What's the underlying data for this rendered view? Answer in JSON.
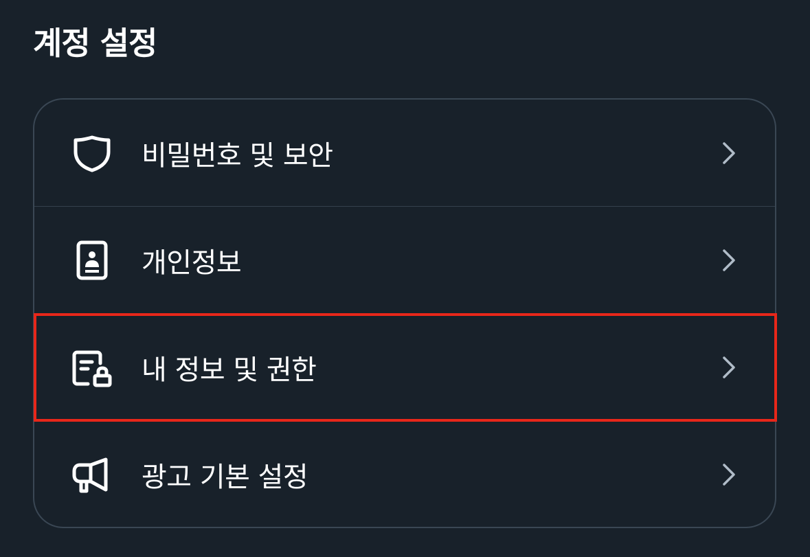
{
  "section": {
    "title": "계정 설정"
  },
  "menu": {
    "items": [
      {
        "label": "비밀번호 및 보안",
        "icon": "shield-icon"
      },
      {
        "label": "개인정보",
        "icon": "id-card-icon"
      },
      {
        "label": "내 정보 및 권한",
        "icon": "document-lock-icon"
      },
      {
        "label": "광고 기본 설정",
        "icon": "megaphone-icon"
      }
    ],
    "highlighted_index": 2
  },
  "colors": {
    "background": "#18212a",
    "border": "#3a4754",
    "chevron": "#b0bcc8",
    "highlight": "#e8271a"
  }
}
